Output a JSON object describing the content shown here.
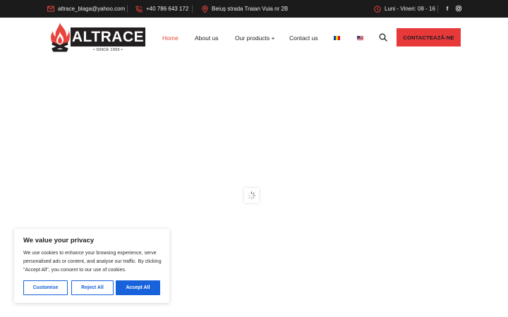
{
  "topbar": {
    "email": "altrace_blaga@yahoo.com",
    "phone": "+40 786 643 172",
    "address": "Beiuș strada Traian Vuia nr 2B",
    "hours": "Luni - Vineri: 08 - 16",
    "icons": [
      "envelope-icon",
      "phone-icon",
      "map-pin-icon",
      "clock-icon",
      "facebook-icon",
      "instagram-icon"
    ],
    "facebook_glyph": "f"
  },
  "logo": {
    "name": "ALTRACE",
    "since": "• SINCE 1993 •"
  },
  "nav": {
    "home": "Home",
    "about": "About us",
    "products": "Our products +",
    "contact": "Contact us",
    "languages": [
      "ro",
      "en"
    ]
  },
  "cta": "CONTACTEAZĂ-NE",
  "cookie": {
    "title": "We value your privacy",
    "text": "We use cookies to enhance your browsing experience, serve personalised ads or content, and analyse our traffic. By clicking \"Accept All\", you consent to our use of cookies.",
    "customise": "Customise",
    "reject": "Reject All",
    "accept": "Accept All"
  },
  "colors": {
    "accent": "#e8453c",
    "topbar_bg": "#1b1b1b",
    "cookie_blue": "#1863dc"
  }
}
